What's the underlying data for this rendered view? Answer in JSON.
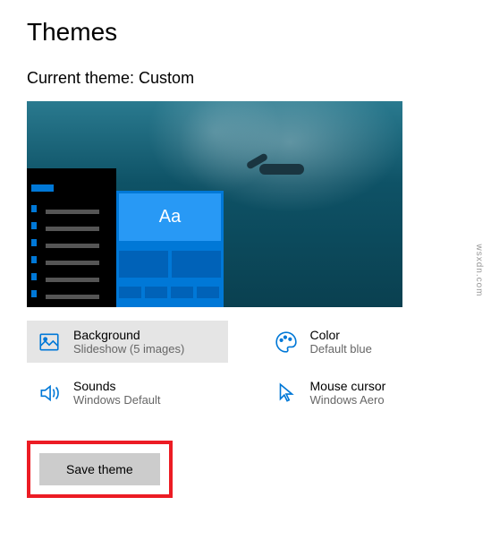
{
  "page": {
    "title": "Themes",
    "current_theme_label": "Current theme: Custom"
  },
  "options": {
    "background": {
      "title": "Background",
      "subtitle": "Slideshow (5 images)"
    },
    "color": {
      "title": "Color",
      "subtitle": "Default blue"
    },
    "sounds": {
      "title": "Sounds",
      "subtitle": "Windows Default"
    },
    "cursor": {
      "title": "Mouse cursor",
      "subtitle": "Windows Aero"
    }
  },
  "preview": {
    "sample_text": "Aa"
  },
  "buttons": {
    "save_theme": "Save theme"
  },
  "watermark": "wsxdn.com"
}
